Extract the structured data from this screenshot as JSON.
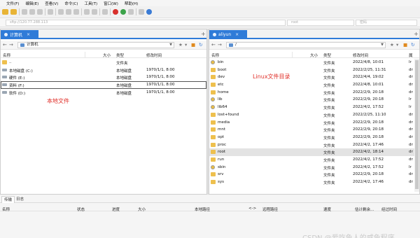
{
  "menu": [
    "文件(F)",
    "编辑(E)",
    "查看(V)",
    "命令(C)",
    "工具(T)",
    "窗口(W)",
    "帮助(H)"
  ],
  "address": {
    "host_placeholder": "sftp://120.77.288.113",
    "user_placeholder": "root",
    "pass_placeholder": "密码"
  },
  "left": {
    "tab_label": "计算机",
    "path": "计算机",
    "columns": {
      "name": "名称",
      "size": "大小",
      "type": "类型",
      "modified": "修改时间"
    },
    "rows": [
      {
        "name": "..",
        "size": "",
        "type": "文件夹",
        "modified": ""
      },
      {
        "name": "本地磁盘 (C:)",
        "size": "",
        "type": "本地磁盘",
        "modified": "1970/1/1, 8:00"
      },
      {
        "name": "硬件 (E:)",
        "size": "",
        "type": "本地磁盘",
        "modified": "1970/1/1, 8:00"
      },
      {
        "name": "资料 (F:)",
        "size": "",
        "type": "本地磁盘",
        "modified": "1970/1/1, 8:00"
      },
      {
        "name": "软件 (D:)",
        "size": "",
        "type": "本地磁盘",
        "modified": "1970/1/1, 8:00"
      }
    ],
    "annotation": "本地文件"
  },
  "right": {
    "tab_label": "aliyun",
    "path": "/",
    "columns": {
      "name": "名称",
      "size": "大小",
      "type": "类型",
      "modified": "修改时间",
      "extra": "属"
    },
    "annotation": "Linux文件目录",
    "rows": [
      {
        "name": "bin",
        "type": "文件夹",
        "modified": "2022/4/8, 10:01",
        "attr": "lr",
        "icon": "link"
      },
      {
        "name": "boot",
        "type": "文件夹",
        "modified": "2022/2/25, 11:31",
        "attr": "dr",
        "icon": "folder"
      },
      {
        "name": "dev",
        "type": "文件夹",
        "modified": "2022/4/4, 19:02",
        "attr": "dr",
        "icon": "folder"
      },
      {
        "name": "etc",
        "type": "文件夹",
        "modified": "2022/4/8, 10:01",
        "attr": "dr",
        "icon": "folder"
      },
      {
        "name": "home",
        "type": "文件夹",
        "modified": "2022/2/9, 20:18",
        "attr": "dr",
        "icon": "folder"
      },
      {
        "name": "lib",
        "type": "文件夹",
        "modified": "2022/2/9, 20:18",
        "attr": "lr",
        "icon": "link"
      },
      {
        "name": "lib64",
        "type": "文件夹",
        "modified": "2022/4/2, 17:52",
        "attr": "lr",
        "icon": "link"
      },
      {
        "name": "lost+found",
        "type": "文件夹",
        "modified": "2022/2/25, 11:10",
        "attr": "dr",
        "icon": "folder"
      },
      {
        "name": "media",
        "type": "文件夹",
        "modified": "2022/2/9, 20:18",
        "attr": "dr",
        "icon": "folder"
      },
      {
        "name": "mnt",
        "type": "文件夹",
        "modified": "2022/2/9, 20:18",
        "attr": "dr",
        "icon": "folder"
      },
      {
        "name": "opt",
        "type": "文件夹",
        "modified": "2022/2/9, 20:18",
        "attr": "dr",
        "icon": "folder"
      },
      {
        "name": "proc",
        "type": "文件夹",
        "modified": "2022/4/2, 17:46",
        "attr": "dr",
        "icon": "folder"
      },
      {
        "name": "root",
        "type": "文件夹",
        "modified": "2022/4/2, 18:14",
        "attr": "dr",
        "icon": "folder",
        "selected": true
      },
      {
        "name": "run",
        "type": "文件夹",
        "modified": "2022/4/2, 17:52",
        "attr": "dr",
        "icon": "folder"
      },
      {
        "name": "sbin",
        "type": "文件夹",
        "modified": "2022/4/2, 17:52",
        "attr": "lr",
        "icon": "link"
      },
      {
        "name": "srv",
        "type": "文件夹",
        "modified": "2022/2/9, 20:18",
        "attr": "dr",
        "icon": "folder"
      },
      {
        "name": "sys",
        "type": "文件夹",
        "modified": "2022/4/2, 17:46",
        "attr": "dr",
        "icon": "folder"
      }
    ]
  },
  "bottom": {
    "tabs": [
      "传输",
      "日志"
    ],
    "columns": [
      "名称",
      "状态",
      "进度",
      "大小",
      "本地路径",
      "<->",
      "远程路径",
      "速度",
      "估计剩余...",
      "经过时间"
    ],
    "watermark": "CSDN @爱吃鱼人的咸鱼程序"
  }
}
